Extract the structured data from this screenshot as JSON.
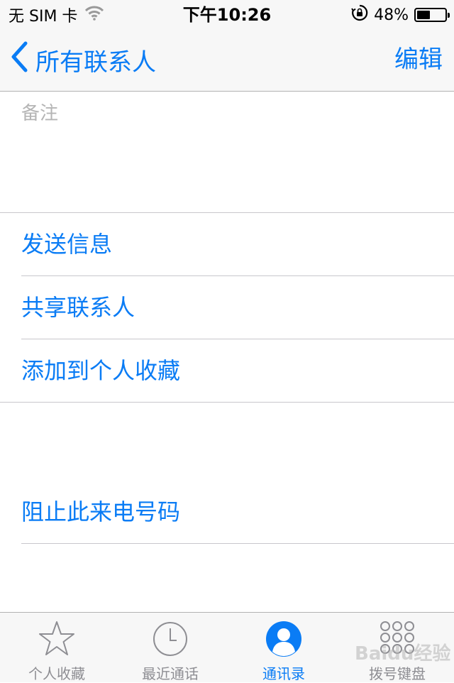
{
  "status_bar": {
    "carrier": "无 SIM 卡",
    "time": "下午10:26",
    "battery_percent_text": "48%",
    "battery_level": 0.48
  },
  "nav": {
    "back_label": "所有联系人",
    "edit_label": "编辑"
  },
  "notes": {
    "label": "备注"
  },
  "actions": {
    "send_message": "发送信息",
    "share_contact": "共享联系人",
    "add_to_favorites": "添加到个人收藏",
    "block_caller": "阻止此来电号码"
  },
  "tabs": [
    {
      "label": "个人收藏",
      "icon": "star-icon",
      "active": false
    },
    {
      "label": "最近通话",
      "icon": "clock-icon",
      "active": false
    },
    {
      "label": "通讯录",
      "icon": "contacts-icon",
      "active": true
    },
    {
      "label": "拨号键盘",
      "icon": "keypad-icon",
      "active": false
    }
  ],
  "colors": {
    "accent": "#0a7cf5",
    "bar_background": "#f7f7f7",
    "inactive_tab": "#8e8e93"
  },
  "watermark": "Baidu经验"
}
